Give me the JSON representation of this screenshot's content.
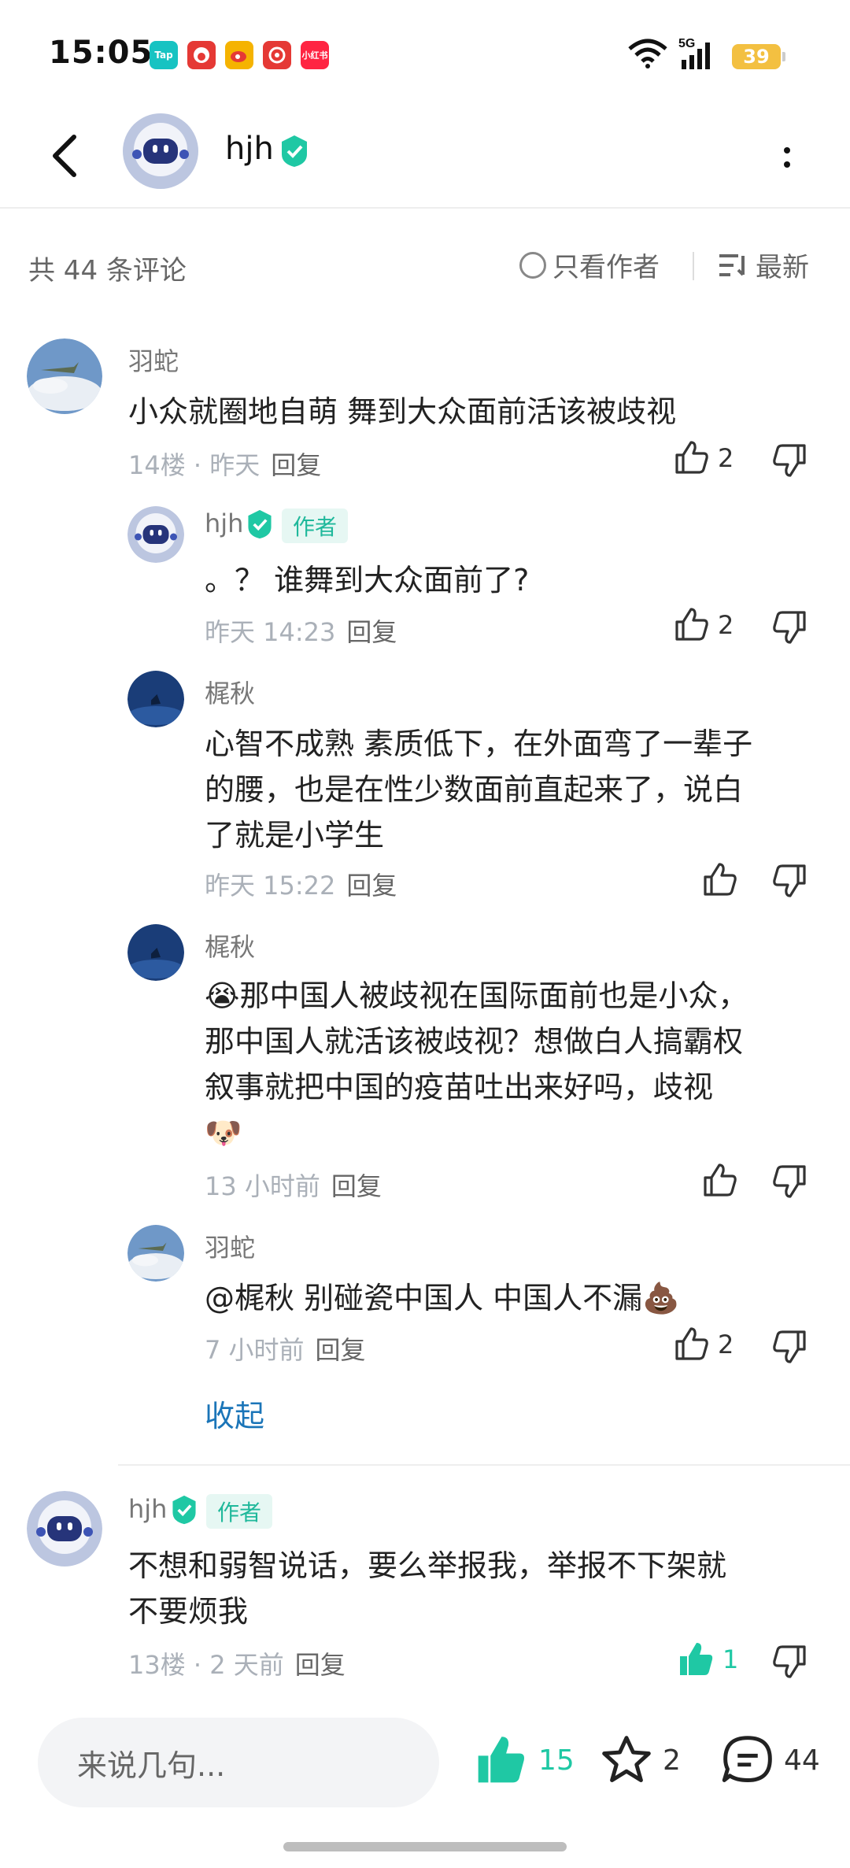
{
  "status": {
    "time": "15:05",
    "battery": "39",
    "network": "5G",
    "app_icons": [
      {
        "label": "Tap",
        "color": "#17c3c2"
      },
      {
        "label": "",
        "color": "#e53935"
      },
      {
        "label": "",
        "color": "#f5b301"
      },
      {
        "label": "",
        "color": "#e53935"
      },
      {
        "label": "小红书",
        "color": "#ff2442"
      }
    ]
  },
  "header": {
    "username": "hjh"
  },
  "filters": {
    "count": "共 44 条评论",
    "author_only": "只看作者",
    "sort": "最新"
  },
  "comments": [
    {
      "user": "羽蛇",
      "text": "小众就圈地自萌 舞到大众面前活该被歧视",
      "floor": "14楼 · 昨天",
      "reply": "回复",
      "likes": "2"
    },
    {
      "user": "hjh",
      "tag": "作者",
      "text": "。？ 谁舞到大众面前了?",
      "time": "昨天 14:23",
      "reply": "回复",
      "likes": "2"
    },
    {
      "user": "梶秋",
      "text_lines": [
        "心智不成熟 素质低下，在外面弯了一辈子",
        "的腰，也是在性少数面前直起来了，说白",
        "了就是小学生"
      ],
      "time": "昨天 15:22",
      "reply": "回复"
    },
    {
      "user": "梶秋",
      "text_lines": [
        "😭那中国人被歧视在国际面前也是小众，",
        "那中国人就活该被歧视？想做白人搞霸权",
        "叙事就把中国的疫苗吐出来好吗，歧视",
        "🐶"
      ],
      "time": "13 小时前",
      "reply": "回复"
    },
    {
      "user": "羽蛇",
      "text": "@梶秋  别碰瓷中国人 中国人不漏💩",
      "time": "7 小时前",
      "reply": "回复",
      "likes": "2"
    },
    {
      "user": "hjh",
      "tag": "作者",
      "text_lines": [
        "不想和弱智说话，要么举报我，举报不下架就",
        "不要烦我"
      ],
      "floor": "13楼 · 2 天前",
      "reply": "回复",
      "likes": "1"
    }
  ],
  "collapse": "收起",
  "bottom": {
    "placeholder": "来说几句...",
    "likes": "15",
    "stars": "2",
    "comments": "44"
  },
  "colors": {
    "accent": "#1fc8a4",
    "link": "#1b75b8",
    "author_tag_bg": "#e6f7f3"
  }
}
